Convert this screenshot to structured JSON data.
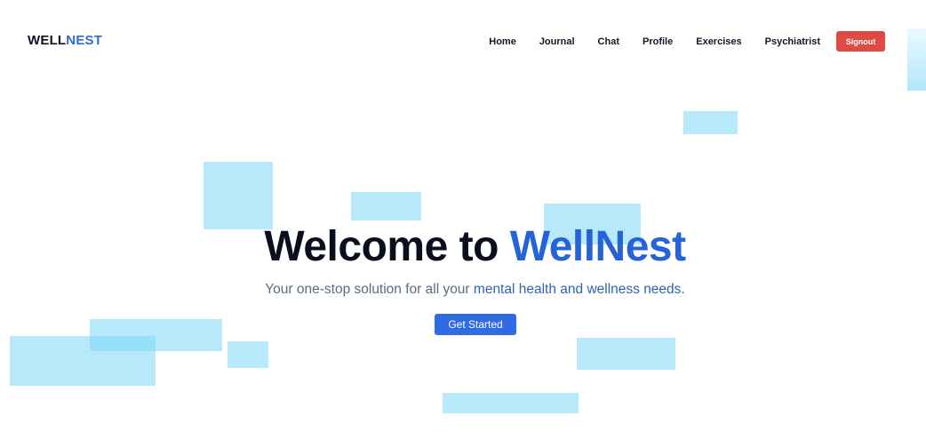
{
  "colors": {
    "brand_blue": "#2563d6",
    "signout_red": "#e04a45",
    "cta_blue": "#2f6be3",
    "decor_cyan": "#7dd7f8"
  },
  "logo": {
    "part1": "WELL",
    "part2": "NEST"
  },
  "nav": {
    "items": [
      {
        "label": "Home"
      },
      {
        "label": "Journal"
      },
      {
        "label": "Chat"
      },
      {
        "label": "Profile"
      },
      {
        "label": "Exercises"
      },
      {
        "label": "Psychiatrist"
      }
    ],
    "signout_label": "Signout"
  },
  "hero": {
    "title_prefix": "Welcome to ",
    "title_brand": "WellNest",
    "subtitle_prefix": "Your one-stop solution for all your ",
    "subtitle_accent": "mental health and wellness needs.",
    "cta_label": "Get Started"
  }
}
